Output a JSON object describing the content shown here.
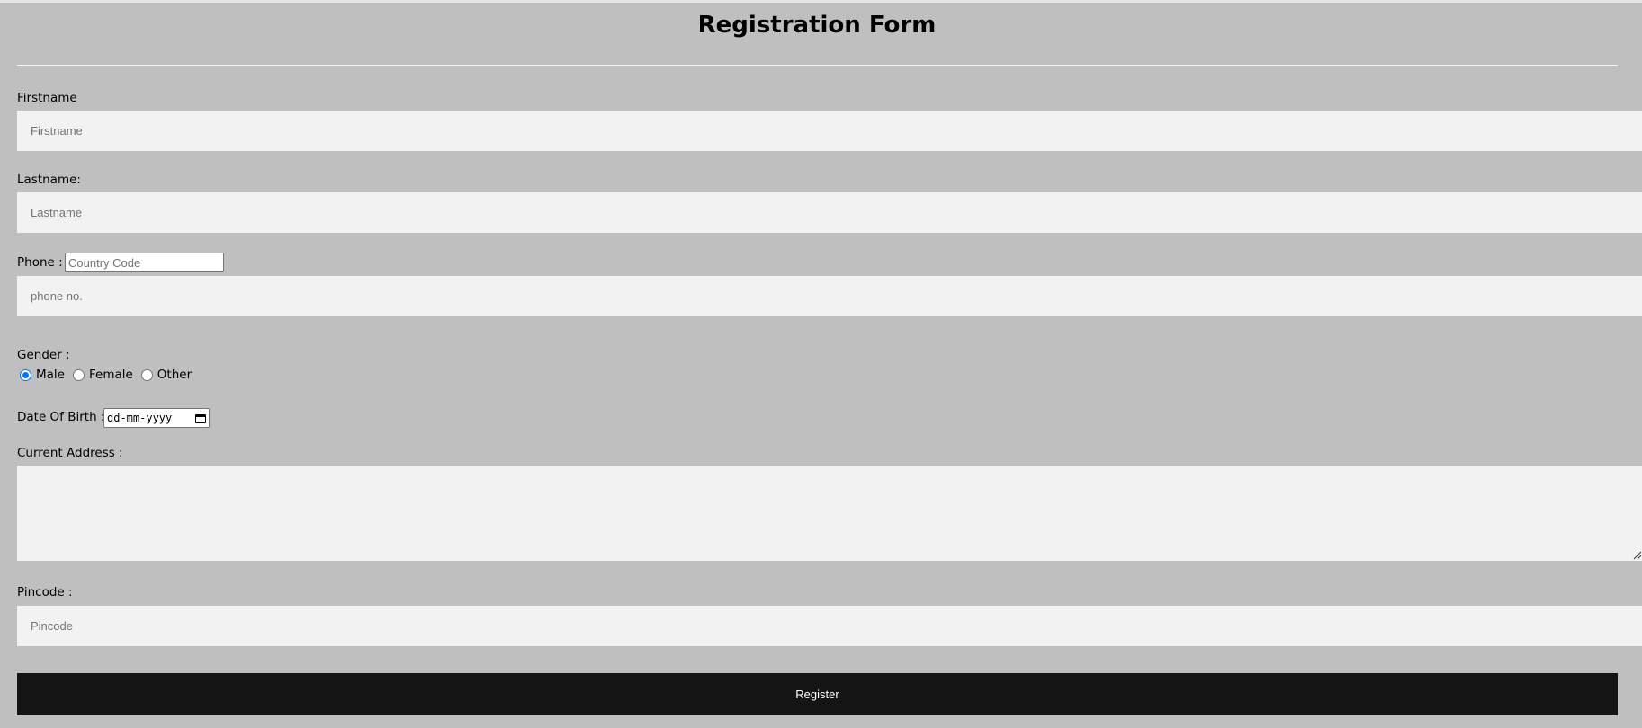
{
  "form": {
    "title": "Registration Form",
    "firstname": {
      "label": "Firstname",
      "placeholder": "Firstname"
    },
    "lastname": {
      "label": "Lastname:",
      "placeholder": "Lastname"
    },
    "phone": {
      "label": "Phone :",
      "country_code_placeholder": "Country Code",
      "number_placeholder": "phone no."
    },
    "gender": {
      "label": "Gender :",
      "options": [
        "Male",
        "Female",
        "Other"
      ],
      "selected": "Male"
    },
    "dob": {
      "label": "Date Of Birth :",
      "value": "dd-mm-yyyy"
    },
    "address": {
      "label": "Current Address :"
    },
    "pincode": {
      "label": "Pincode :",
      "placeholder": "Pincode"
    },
    "register_label": "Register"
  },
  "colors": {
    "background": "#bfbfbf",
    "field_background": "#f2f2f2",
    "button_background": "#141414",
    "radio_accent": "#0075ff"
  }
}
